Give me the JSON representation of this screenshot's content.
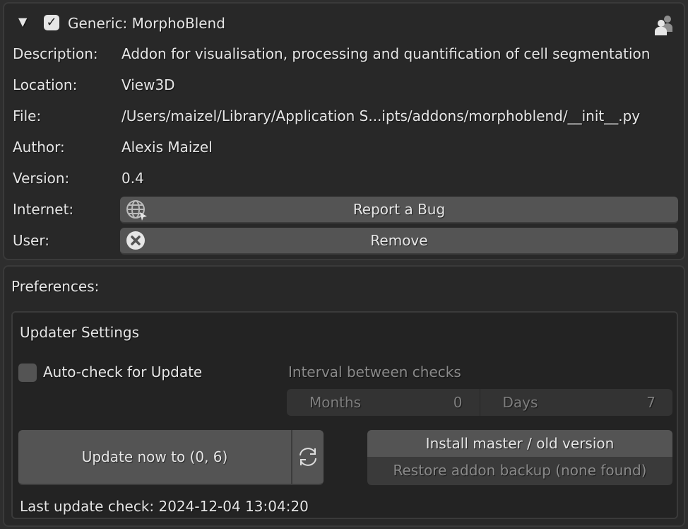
{
  "addon": {
    "header": "Generic: MorphoBlend",
    "enabled": true,
    "rows": [
      {
        "label": "Description:",
        "value": "Addon for visualisation, processing and quantification of cell segmentation"
      },
      {
        "label": "Location:",
        "value": "View3D"
      },
      {
        "label": "File:",
        "value": "/Users/maizel/Library/Application S...ipts/addons/morphoblend/__init__.py"
      },
      {
        "label": "Author:",
        "value": "Alexis Maizel"
      },
      {
        "label": "Version:",
        "value": "0.4"
      }
    ],
    "internet_label": "Internet:",
    "report_bug": "Report a Bug",
    "user_label": "User:",
    "remove": "Remove"
  },
  "prefs": {
    "title": "Preferences:",
    "updater": {
      "title": "Updater Settings",
      "auto_check": "Auto-check for Update",
      "auto_check_enabled": false,
      "interval_label": "Interval between checks",
      "months_label": "Months",
      "months": "0",
      "days_label": "Days",
      "days": "7",
      "update_now": "Update now to (0, 6)",
      "install_master": "Install master / old version",
      "restore_backup": "Restore addon backup (none found)",
      "last_check": "Last update check: 2024-12-04 13:04:20"
    }
  }
}
